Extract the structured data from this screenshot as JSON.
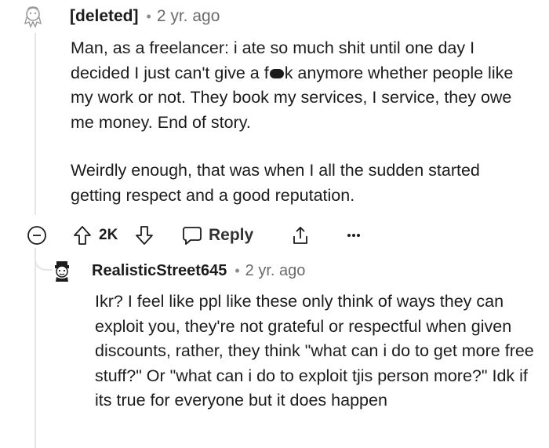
{
  "parent_comment": {
    "author": "[deleted]",
    "separator": "•",
    "timestamp": "2 yr. ago",
    "paragraphs": [
      {
        "before_censor": "Man, as a freelancer: i ate so much shit until one day I decided I just can't give a f",
        "after_censor": "k anymore whether people like my work or not. They book my services, I service, they owe me money. End of story."
      },
      {
        "text": "Weirdly enough, that was when I all the sudden started getting respect and a good reputation."
      }
    ],
    "actions": {
      "collapse_icon": "collapse-minus-icon",
      "upvote_icon": "upvote-arrow-icon",
      "score": "2K",
      "downvote_icon": "downvote-arrow-icon",
      "reply_icon": "comment-bubble-icon",
      "reply_label": "Reply",
      "share_icon": "share-icon",
      "more_icon": "more-dots-icon"
    }
  },
  "reply_comment": {
    "author": "RealisticStreet645",
    "separator": "•",
    "timestamp": "2 yr. ago",
    "text": "Ikr? I feel like ppl like these only think of ways they can exploit you, they're not grateful or respectful when given discounts, rather, they think \"what can i do to get more free stuff?\" Or \"what can i do to exploit tjis person more?\" Idk if its true for everyone but it does happen"
  },
  "colors": {
    "text": "#1c1c1c",
    "meta": "#6b6b6b",
    "thread_line": "#e5e5e5"
  }
}
